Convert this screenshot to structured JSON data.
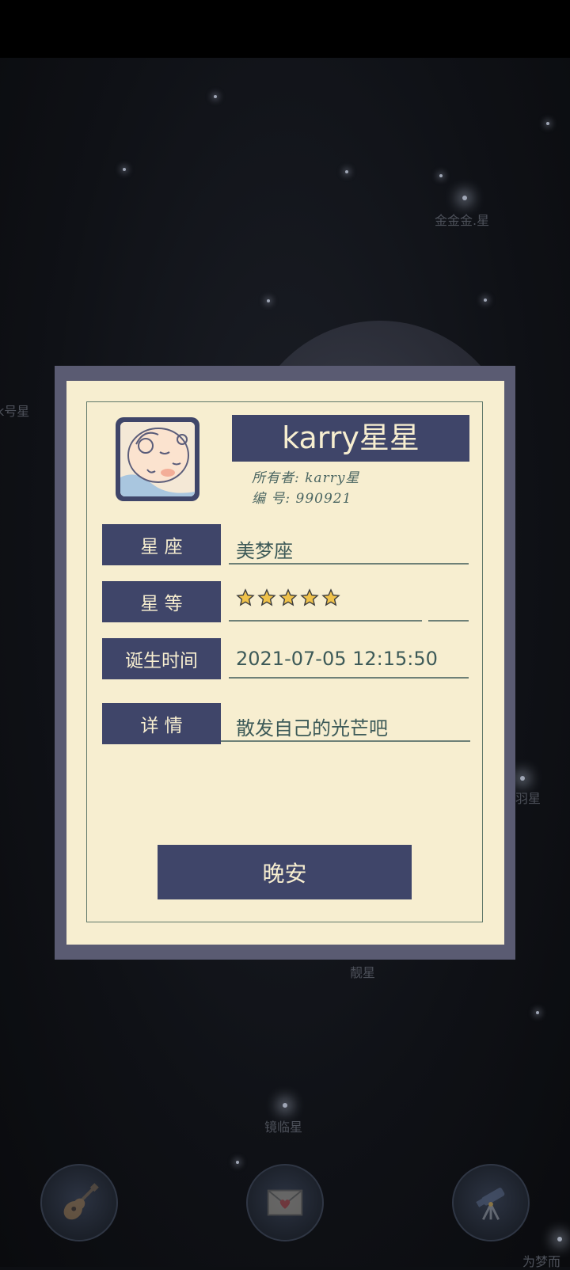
{
  "background_star_labels": [
    {
      "id": "jin",
      "text": "金金金.星"
    },
    {
      "id": "hao",
      "text": "k号星"
    },
    {
      "id": "yu",
      "text": "羽星"
    },
    {
      "id": "liang",
      "text": "靓星"
    },
    {
      "id": "jing",
      "text": "镜临星"
    },
    {
      "id": "wei",
      "text": "为梦而"
    }
  ],
  "card": {
    "title": "karry星星",
    "owner_line": "所有者: karry星",
    "number_line": "编   号: 990921",
    "fields": {
      "constellation": {
        "label": "星  座",
        "value": "美梦座"
      },
      "magnitude": {
        "label": "星  等",
        "stars": 5,
        "max_stars": 5
      },
      "birth_time": {
        "label": "诞生时间",
        "value": "2021-07-05 12:15:50"
      },
      "details": {
        "label": "详  情",
        "value": "散发自己的光芒吧"
      }
    },
    "button_label": "晚安"
  },
  "nav": [
    {
      "name": "guitar-icon"
    },
    {
      "name": "mail-heart-icon"
    },
    {
      "name": "telescope-icon"
    }
  ],
  "colors": {
    "navy": "#3f4569",
    "paper": "#f7eed0",
    "teal_text": "#3d5a58",
    "star_gold": "#f0c24a"
  }
}
